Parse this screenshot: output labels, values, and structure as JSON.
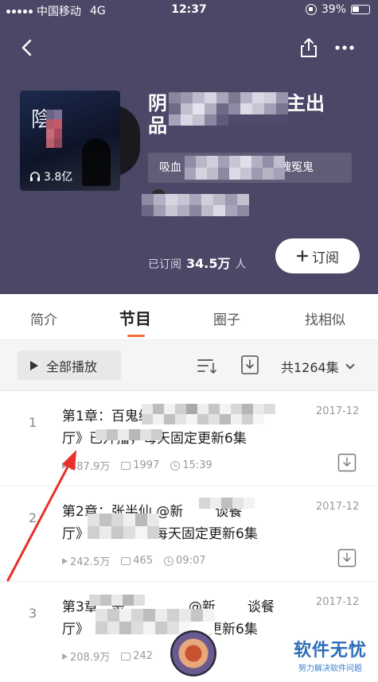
{
  "status_bar": {
    "carrier": "中国移动",
    "network": "4G",
    "time": "12:37",
    "battery": "39%"
  },
  "album": {
    "cover_glyph": "陰",
    "play_count": "3.8亿",
    "title_part1": "阴",
    "title_part2": "主出",
    "title_part3": "品",
    "author_part1": "吸血",
    "author_part2": "阴魂冤鬼",
    "subscribed_label": "已订阅",
    "subscribed_count": "34.5万",
    "subscribed_unit": "人",
    "subscribe_button": "订阅"
  },
  "tabs": [
    {
      "label": "简介"
    },
    {
      "label": "节目"
    },
    {
      "label": "圈子"
    },
    {
      "label": "找相似"
    }
  ],
  "toolbar": {
    "play_all": "全部播放",
    "total": "共1264集"
  },
  "episodes": [
    {
      "index": "1",
      "title_a": "第1章：百鬼缠身 @新",
      "title_b": "谈餐",
      "title_c": "厅》已开播，每天固定更新6集",
      "date": "2017-12",
      "plays": "387.9万",
      "comments": "1997",
      "duration": "15:39"
    },
    {
      "index": "2",
      "title_a": "第2章：张半仙 @新",
      "title_b": "谈餐",
      "title_c": "厅》",
      "title_d": "每天固定更新6集",
      "date": "2017-12",
      "plays": "242.5万",
      "comments": "465",
      "duration": "09:07"
    },
    {
      "index": "3",
      "title_a": "第3章：恶",
      "title_b": "@新",
      "title_b2": "谈餐",
      "title_c": "厅》",
      "title_d": "更新6集",
      "date": "2017-12",
      "plays": "208.9万",
      "comments": "242"
    }
  ],
  "watermark": {
    "big": "软件无忧",
    "small": "努力解决软件问题"
  },
  "colors": {
    "hero_bg": "#4b4766",
    "accent": "#f26b3a",
    "annotation_red": "#e8312b"
  }
}
